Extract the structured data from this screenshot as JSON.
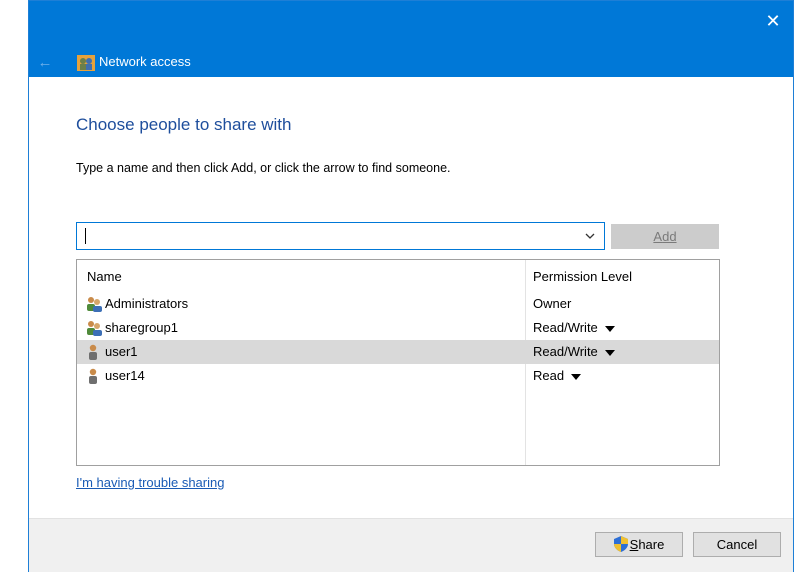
{
  "window": {
    "close_label": "✕",
    "back_label": "←",
    "nav_title": "Network access"
  },
  "main": {
    "heading": "Choose people to share with",
    "instruction": "Type a name and then click Add, or click the arrow to find someone.",
    "name_input": {
      "value": "",
      "placeholder": ""
    },
    "add_button": {
      "first": "A",
      "rest": "dd"
    }
  },
  "list": {
    "columns": {
      "name": "Name",
      "permission": "Permission Level"
    },
    "rows": [
      {
        "name": "Administrators",
        "permission": "Owner",
        "icon": "group-icon",
        "has_dropdown": false
      },
      {
        "name": "sharegroup1",
        "permission": "Read/Write",
        "icon": "group-icon",
        "has_dropdown": true
      },
      {
        "name": "user1",
        "permission": "Read/Write",
        "icon": "user-icon",
        "has_dropdown": true,
        "selected": true
      },
      {
        "name": "user14",
        "permission": "Read",
        "icon": "user-icon",
        "has_dropdown": true
      }
    ]
  },
  "links": {
    "trouble": "I'm having trouble sharing"
  },
  "footer": {
    "share": {
      "first": "S",
      "rest": "hare"
    },
    "cancel": "Cancel"
  },
  "colors": {
    "titlebar": "#0078d7",
    "heading": "#1e4e9c",
    "selected_row": "#d9d9d9"
  }
}
